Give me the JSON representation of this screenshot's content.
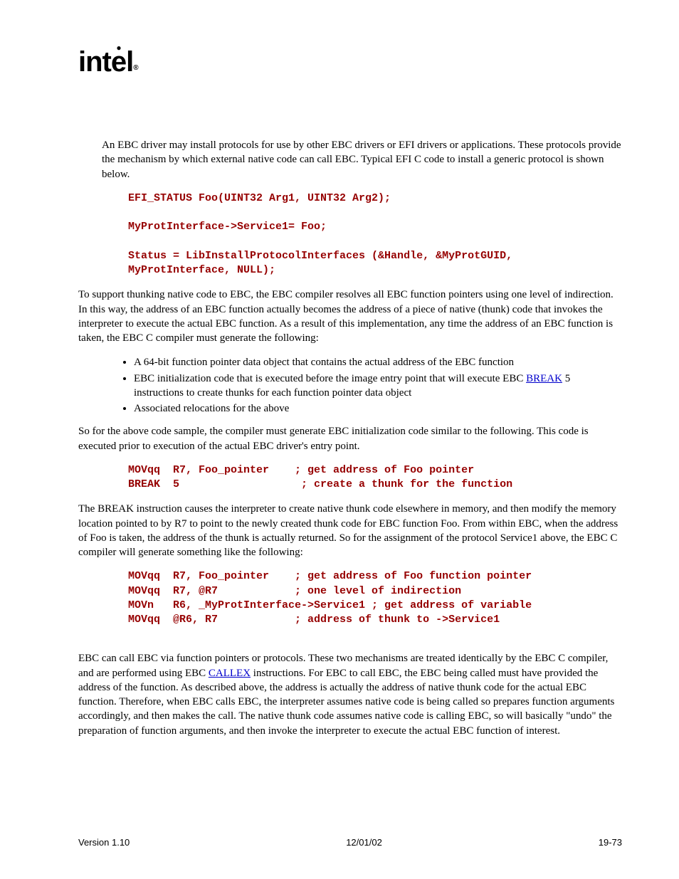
{
  "logo": "intel",
  "p1": "An EBC driver may install protocols for use by other EBC drivers or EFI drivers or applications.  These protocols provide the mechanism by which external native code can call EBC.  Typical EFI C code to install a generic protocol is shown below.",
  "code1": "EFI_STATUS Foo(UINT32 Arg1, UINT32 Arg2);\n\nMyProtInterface->Service1= Foo;\n\nStatus = LibInstallProtocolInterfaces (&Handle, &MyProtGUID,\nMyProtInterface, NULL);",
  "p2": "To support thunking native code to EBC, the EBC compiler resolves all EBC function pointers using one level of indirection.  In this way, the address of an EBC function actually becomes the address of a piece of native (thunk) code that invokes the interpreter to execute the actual EBC function.  As a result of this implementation, any time the address of an EBC function is taken, the EBC C compiler must generate the following:",
  "bullets": {
    "b1": "A 64-bit function pointer data object that contains the actual address of the EBC function",
    "b2a": "EBC initialization code that is executed before the image entry point that will execute EBC ",
    "b2_link": "BREAK",
    "b2b": " 5 instructions to create thunks for each function pointer data object",
    "b3": "Associated relocations for the above"
  },
  "p3": "So for the above code sample, the compiler must generate EBC initialization code similar to the following.  This code is executed prior to execution of the actual EBC driver's entry point.",
  "code2": "MOVqq  R7, Foo_pointer    ; get address of Foo pointer\nBREAK  5                   ; create a thunk for the function",
  "p4": "The BREAK instruction causes the interpreter to create native thunk code elsewhere in memory, and then modify the memory location pointed to by R7 to point to the newly created thunk code for EBC function Foo.  From within EBC, when the address of Foo is taken, the address of the thunk is actually returned.  So for the assignment of the protocol Service1 above, the EBC C compiler will generate something like the following:",
  "code3": "MOVqq  R7, Foo_pointer    ; get address of Foo function pointer\nMOVqq  R7, @R7            ; one level of indirection\nMOVn   R6, _MyProtInterface->Service1 ; get address of variable\nMOVqq  @R6, R7            ; address of thunk to ->Service1",
  "p5a": "EBC can call EBC via function pointers or protocols.  These two mechanisms are treated identically by the EBC C compiler, and are performed using EBC ",
  "p5_link": "CALLEX",
  "p5b": " instructions.  For EBC to call EBC, the EBC being called must have provided the address of the function.  As described above, the address is actually the address of native thunk code for the actual EBC function.  Therefore, when EBC calls EBC, the interpreter assumes native code is being called so prepares function arguments accordingly, and then makes the call.  The native thunk code assumes native code is calling EBC, so will basically \"undo\" the preparation of function arguments, and then invoke the interpreter to execute the actual EBC function of interest.",
  "footer": {
    "left": "Version 1.10",
    "center": "12/01/02",
    "right": "19-73"
  }
}
